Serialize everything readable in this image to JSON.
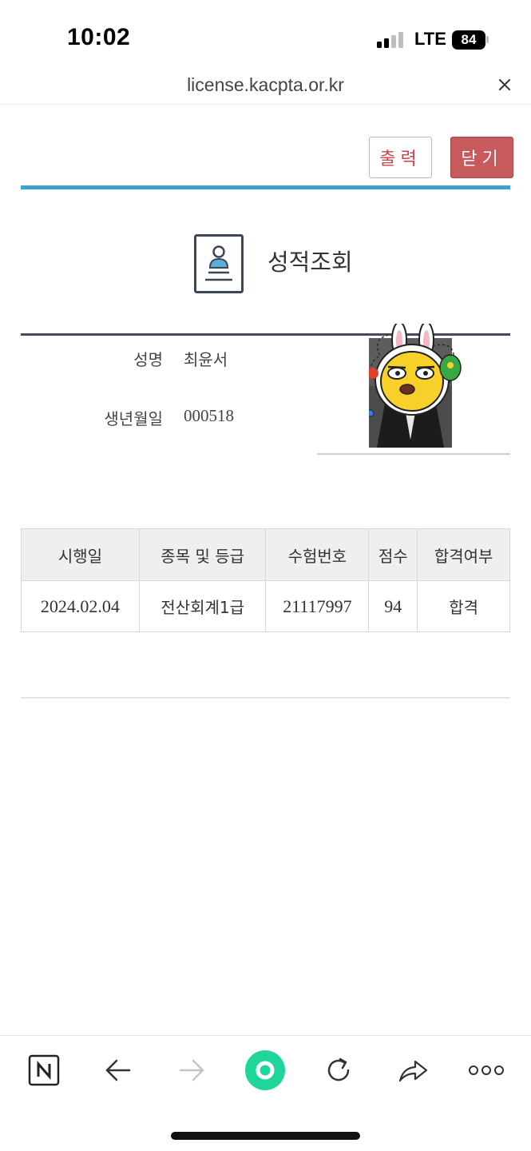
{
  "status_bar": {
    "time": "10:02",
    "network": "LTE",
    "battery": "84"
  },
  "browser": {
    "url": "license.kacpta.or.kr"
  },
  "actions": {
    "print_label": "출력",
    "close_label": "닫기"
  },
  "page": {
    "title": "성적조회"
  },
  "person": {
    "name_label": "성명",
    "name_value": "최윤서",
    "dob_label": "생년월일",
    "dob_value": "000518"
  },
  "results": {
    "headers": [
      "시행일",
      "종목 및 등급",
      "수험번호",
      "점수",
      "합격여부"
    ],
    "rows": [
      [
        "2024.02.04",
        "전산회계1급",
        "21117997",
        "94",
        "합격"
      ]
    ]
  },
  "toolbar": {
    "items": [
      "naver-icon",
      "back-icon",
      "forward-icon",
      "home-green-icon",
      "reload-icon",
      "share-icon",
      "more-icon"
    ]
  },
  "colors": {
    "accent_blue": "#3aa3cf",
    "close_button": "#c65a5c",
    "print_text": "#c9444c",
    "header_bg": "#efefef",
    "green_button": "#1fd69a"
  }
}
